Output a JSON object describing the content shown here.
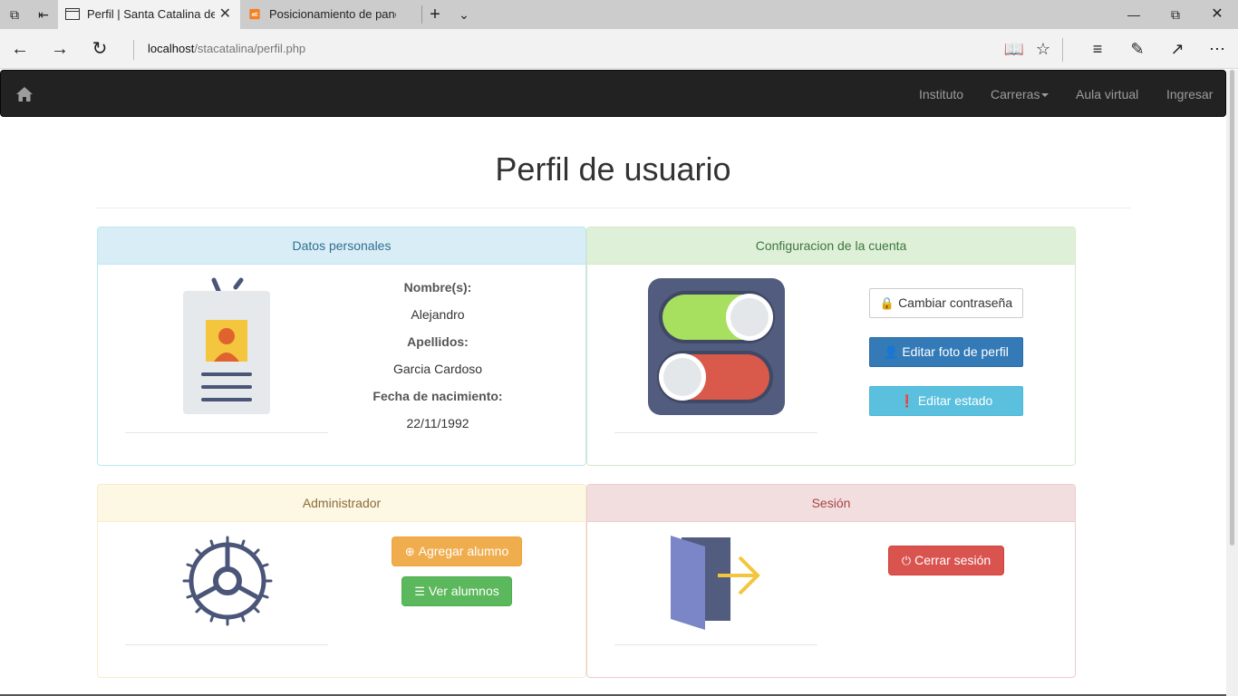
{
  "browser": {
    "tabs": [
      {
        "title": "Perfil | Santa Catalina de"
      },
      {
        "title": "Posicionamiento de paneles"
      }
    ],
    "url_host": "localhost",
    "url_path": "/stacatalina/perfil.php"
  },
  "navbar": {
    "items": [
      "Instituto",
      "Carreras",
      "Aula virtual",
      "Ingresar"
    ]
  },
  "page": {
    "title": "Perfil de usuario"
  },
  "personal": {
    "heading": "Datos personales",
    "name_label": "Nombre(s):",
    "name_value": "Alejandro",
    "surname_label": "Apellidos:",
    "surname_value": "Garcia Cardoso",
    "birth_label": "Fecha de nacimiento:",
    "birth_value": "22/11/1992"
  },
  "account": {
    "heading": "Configuracion de la cuenta",
    "change_password": "Cambiar contraseña",
    "edit_photo": "Editar foto de perfil",
    "edit_status": "Editar estado"
  },
  "admin": {
    "heading": "Administrador",
    "add_student": "Agregar alumno",
    "view_students": "Ver alumnos"
  },
  "session": {
    "heading": "Sesión",
    "logout": "Cerrar sesión"
  },
  "colors": {
    "navbar": "#222222",
    "primary": "#337ab7",
    "info": "#5bc0de",
    "warning": "#f0ad4e",
    "success": "#5cb85c",
    "danger": "#d9534f"
  }
}
